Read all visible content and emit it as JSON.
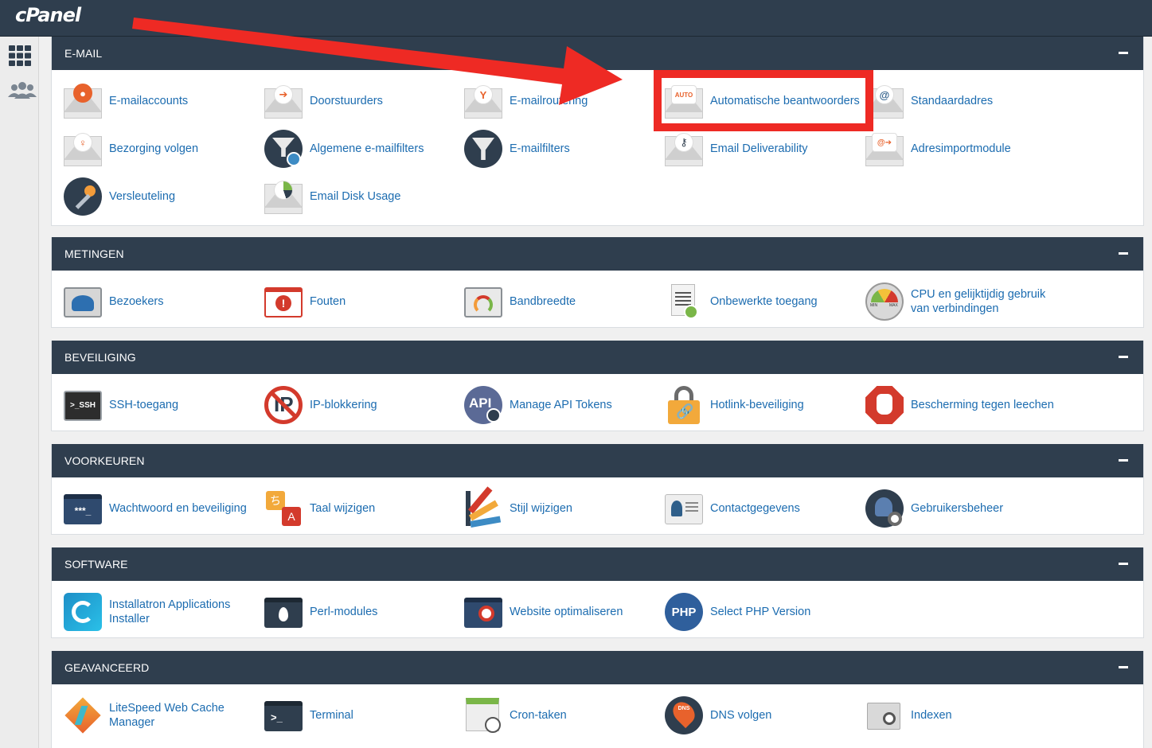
{
  "app": {
    "logo": "cPanel"
  },
  "sidebar": {
    "items": [
      {
        "icon": "grid-icon"
      },
      {
        "icon": "users-icon"
      }
    ]
  },
  "sections": [
    {
      "title": "E-MAIL",
      "items": [
        {
          "label": "E-mailaccounts",
          "icon": "email-account-icon"
        },
        {
          "label": "Doorstuurders",
          "icon": "forwarder-icon"
        },
        {
          "label": "E-mailroutering",
          "icon": "email-routing-icon"
        },
        {
          "label": "Automatische beantwoorders",
          "icon": "autoresponder-icon",
          "badge": "AUTO"
        },
        {
          "label": "Standaardadres",
          "icon": "default-address-icon"
        },
        {
          "label": "Bezorging volgen",
          "icon": "track-delivery-icon"
        },
        {
          "label": "Algemene e-mailfilters",
          "icon": "global-filter-icon"
        },
        {
          "label": "E-mailfilters",
          "icon": "email-filter-icon"
        },
        {
          "label": "Email Deliverability",
          "icon": "deliverability-icon"
        },
        {
          "label": "Adresimportmodule",
          "icon": "address-importer-icon"
        },
        {
          "label": "Versleuteling",
          "icon": "encryption-icon"
        },
        {
          "label": "Email Disk Usage",
          "icon": "disk-usage-icon"
        }
      ]
    },
    {
      "title": "METINGEN",
      "items": [
        {
          "label": "Bezoekers",
          "icon": "visitors-icon"
        },
        {
          "label": "Fouten",
          "icon": "errors-icon"
        },
        {
          "label": "Bandbreedte",
          "icon": "bandwidth-icon"
        },
        {
          "label": "Onbewerkte toegang",
          "icon": "raw-access-icon"
        },
        {
          "label": "CPU en gelijktijdig gebruik van verbindingen",
          "icon": "cpu-gauge-icon",
          "gauge_min": "MIN",
          "gauge_max": "MAX"
        }
      ]
    },
    {
      "title": "BEVEILIGING",
      "items": [
        {
          "label": "SSH-toegang",
          "icon": "ssh-icon",
          "badge": ">_SSH"
        },
        {
          "label": "IP-blokkering",
          "icon": "ip-blocker-icon"
        },
        {
          "label": "Manage API Tokens",
          "icon": "api-tokens-icon",
          "badge": "API"
        },
        {
          "label": "Hotlink-beveiliging",
          "icon": "hotlink-lock-icon"
        },
        {
          "label": "Bescherming tegen leechen",
          "icon": "leech-hand-icon"
        }
      ]
    },
    {
      "title": "VOORKEUREN",
      "items": [
        {
          "label": "Wachtwoord en beveiliging",
          "icon": "password-icon",
          "badge": "***_"
        },
        {
          "label": "Taal wijzigen",
          "icon": "language-icon",
          "badge_a": "ち",
          "badge_b": "A"
        },
        {
          "label": "Stijl wijzigen",
          "icon": "style-palette-icon"
        },
        {
          "label": "Contactgegevens",
          "icon": "contact-card-icon"
        },
        {
          "label": "Gebruikersbeheer",
          "icon": "user-manager-icon"
        }
      ]
    },
    {
      "title": "SOFTWARE",
      "items": [
        {
          "label": "Installatron Applications Installer",
          "icon": "installatron-icon"
        },
        {
          "label": "Perl-modules",
          "icon": "perl-icon"
        },
        {
          "label": "Website optimaliseren",
          "icon": "optimize-icon"
        },
        {
          "label": "Select PHP Version",
          "icon": "php-icon",
          "badge": "PHP"
        }
      ]
    },
    {
      "title": "GEAVANCEERD",
      "items": [
        {
          "label": "LiteSpeed Web Cache Manager",
          "icon": "litespeed-icon"
        },
        {
          "label": "Terminal",
          "icon": "terminal-icon",
          "badge": ">_"
        },
        {
          "label": "Cron-taken",
          "icon": "cron-icon"
        },
        {
          "label": "DNS volgen",
          "icon": "dns-icon",
          "badge": "DNS"
        },
        {
          "label": "Indexen",
          "icon": "indexes-icon"
        }
      ]
    }
  ],
  "colors": {
    "header": "#2f3e4e",
    "link": "#1c6cb0",
    "annotation": "#ee2a24"
  }
}
